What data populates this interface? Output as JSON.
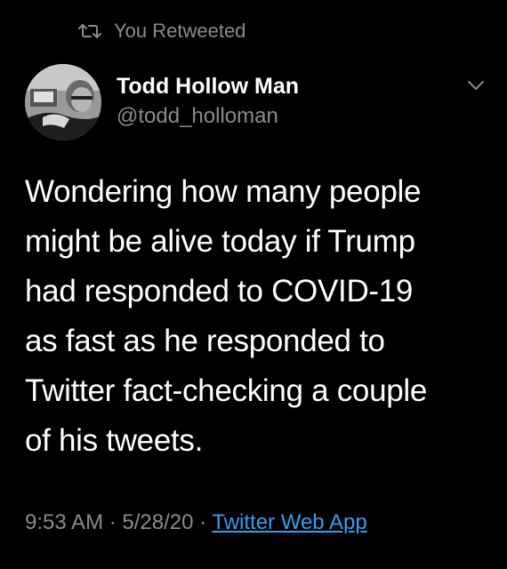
{
  "retweet_notice": {
    "label": "You Retweeted",
    "icon": "retweet-icon"
  },
  "author": {
    "display_name": "Todd Hollow Man",
    "handle": "@todd_holloman",
    "avatar_icon": "profile-photo"
  },
  "menu": {
    "icon": "chevron-down-icon"
  },
  "tweet": {
    "lines": [
      "Wondering how many people",
      "might be alive today if Trump",
      "had responded to COVID-19",
      "as fast as he responded to",
      "Twitter fact-checking a couple",
      "of his tweets."
    ]
  },
  "meta": {
    "time": "9:53 AM",
    "separator": " · ",
    "date": "5/28/20",
    "source": "Twitter Web App"
  },
  "colors": {
    "background": "#000000",
    "primary_text": "#ffffff",
    "secondary_text": "#8b8b8b",
    "link": "#3a9cf0"
  }
}
